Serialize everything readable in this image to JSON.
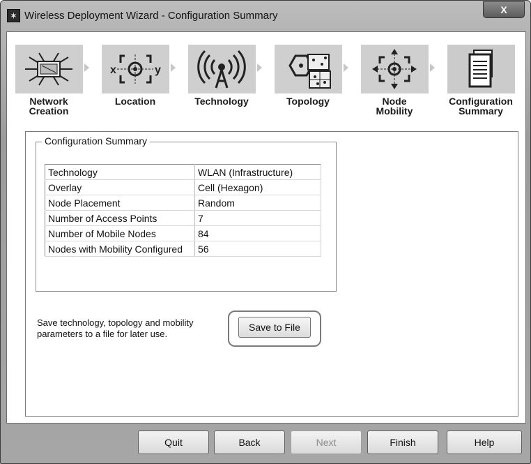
{
  "window": {
    "title": "Wireless Deployment Wizard - Configuration Summary",
    "close_label": "X"
  },
  "steps": [
    {
      "label_line1": "Network",
      "label_line2": "Creation",
      "icon": "network-icon"
    },
    {
      "label_line1": "Location",
      "label_line2": "",
      "icon": "location-icon"
    },
    {
      "label_line1": "Technology",
      "label_line2": "",
      "icon": "wireless-antenna-icon"
    },
    {
      "label_line1": "Topology",
      "label_line2": "",
      "icon": "topology-cells-icon"
    },
    {
      "label_line1": "Node",
      "label_line2": "Mobility",
      "icon": "mobility-arrows-icon"
    },
    {
      "label_line1": "Configuration",
      "label_line2": "Summary",
      "icon": "document-icon"
    }
  ],
  "summary": {
    "group_title": "Configuration Summary",
    "rows": [
      {
        "key": "Technology",
        "value": "WLAN (Infrastructure)"
      },
      {
        "key": "Overlay",
        "value": "Cell (Hexagon)"
      },
      {
        "key": "Node Placement",
        "value": "Random"
      },
      {
        "key": "Number of Access Points",
        "value": "7"
      },
      {
        "key": "Number of Mobile Nodes",
        "value": "84"
      },
      {
        "key": "Nodes with Mobility Configured",
        "value": "56"
      }
    ]
  },
  "save": {
    "description_line1": "Save technology, topology and mobility",
    "description_line2": "parameters to a file for later use.",
    "button_label": "Save to File"
  },
  "footer": {
    "quit": "Quit",
    "back": "Back",
    "next": "Next",
    "finish": "Finish",
    "help": "Help"
  }
}
